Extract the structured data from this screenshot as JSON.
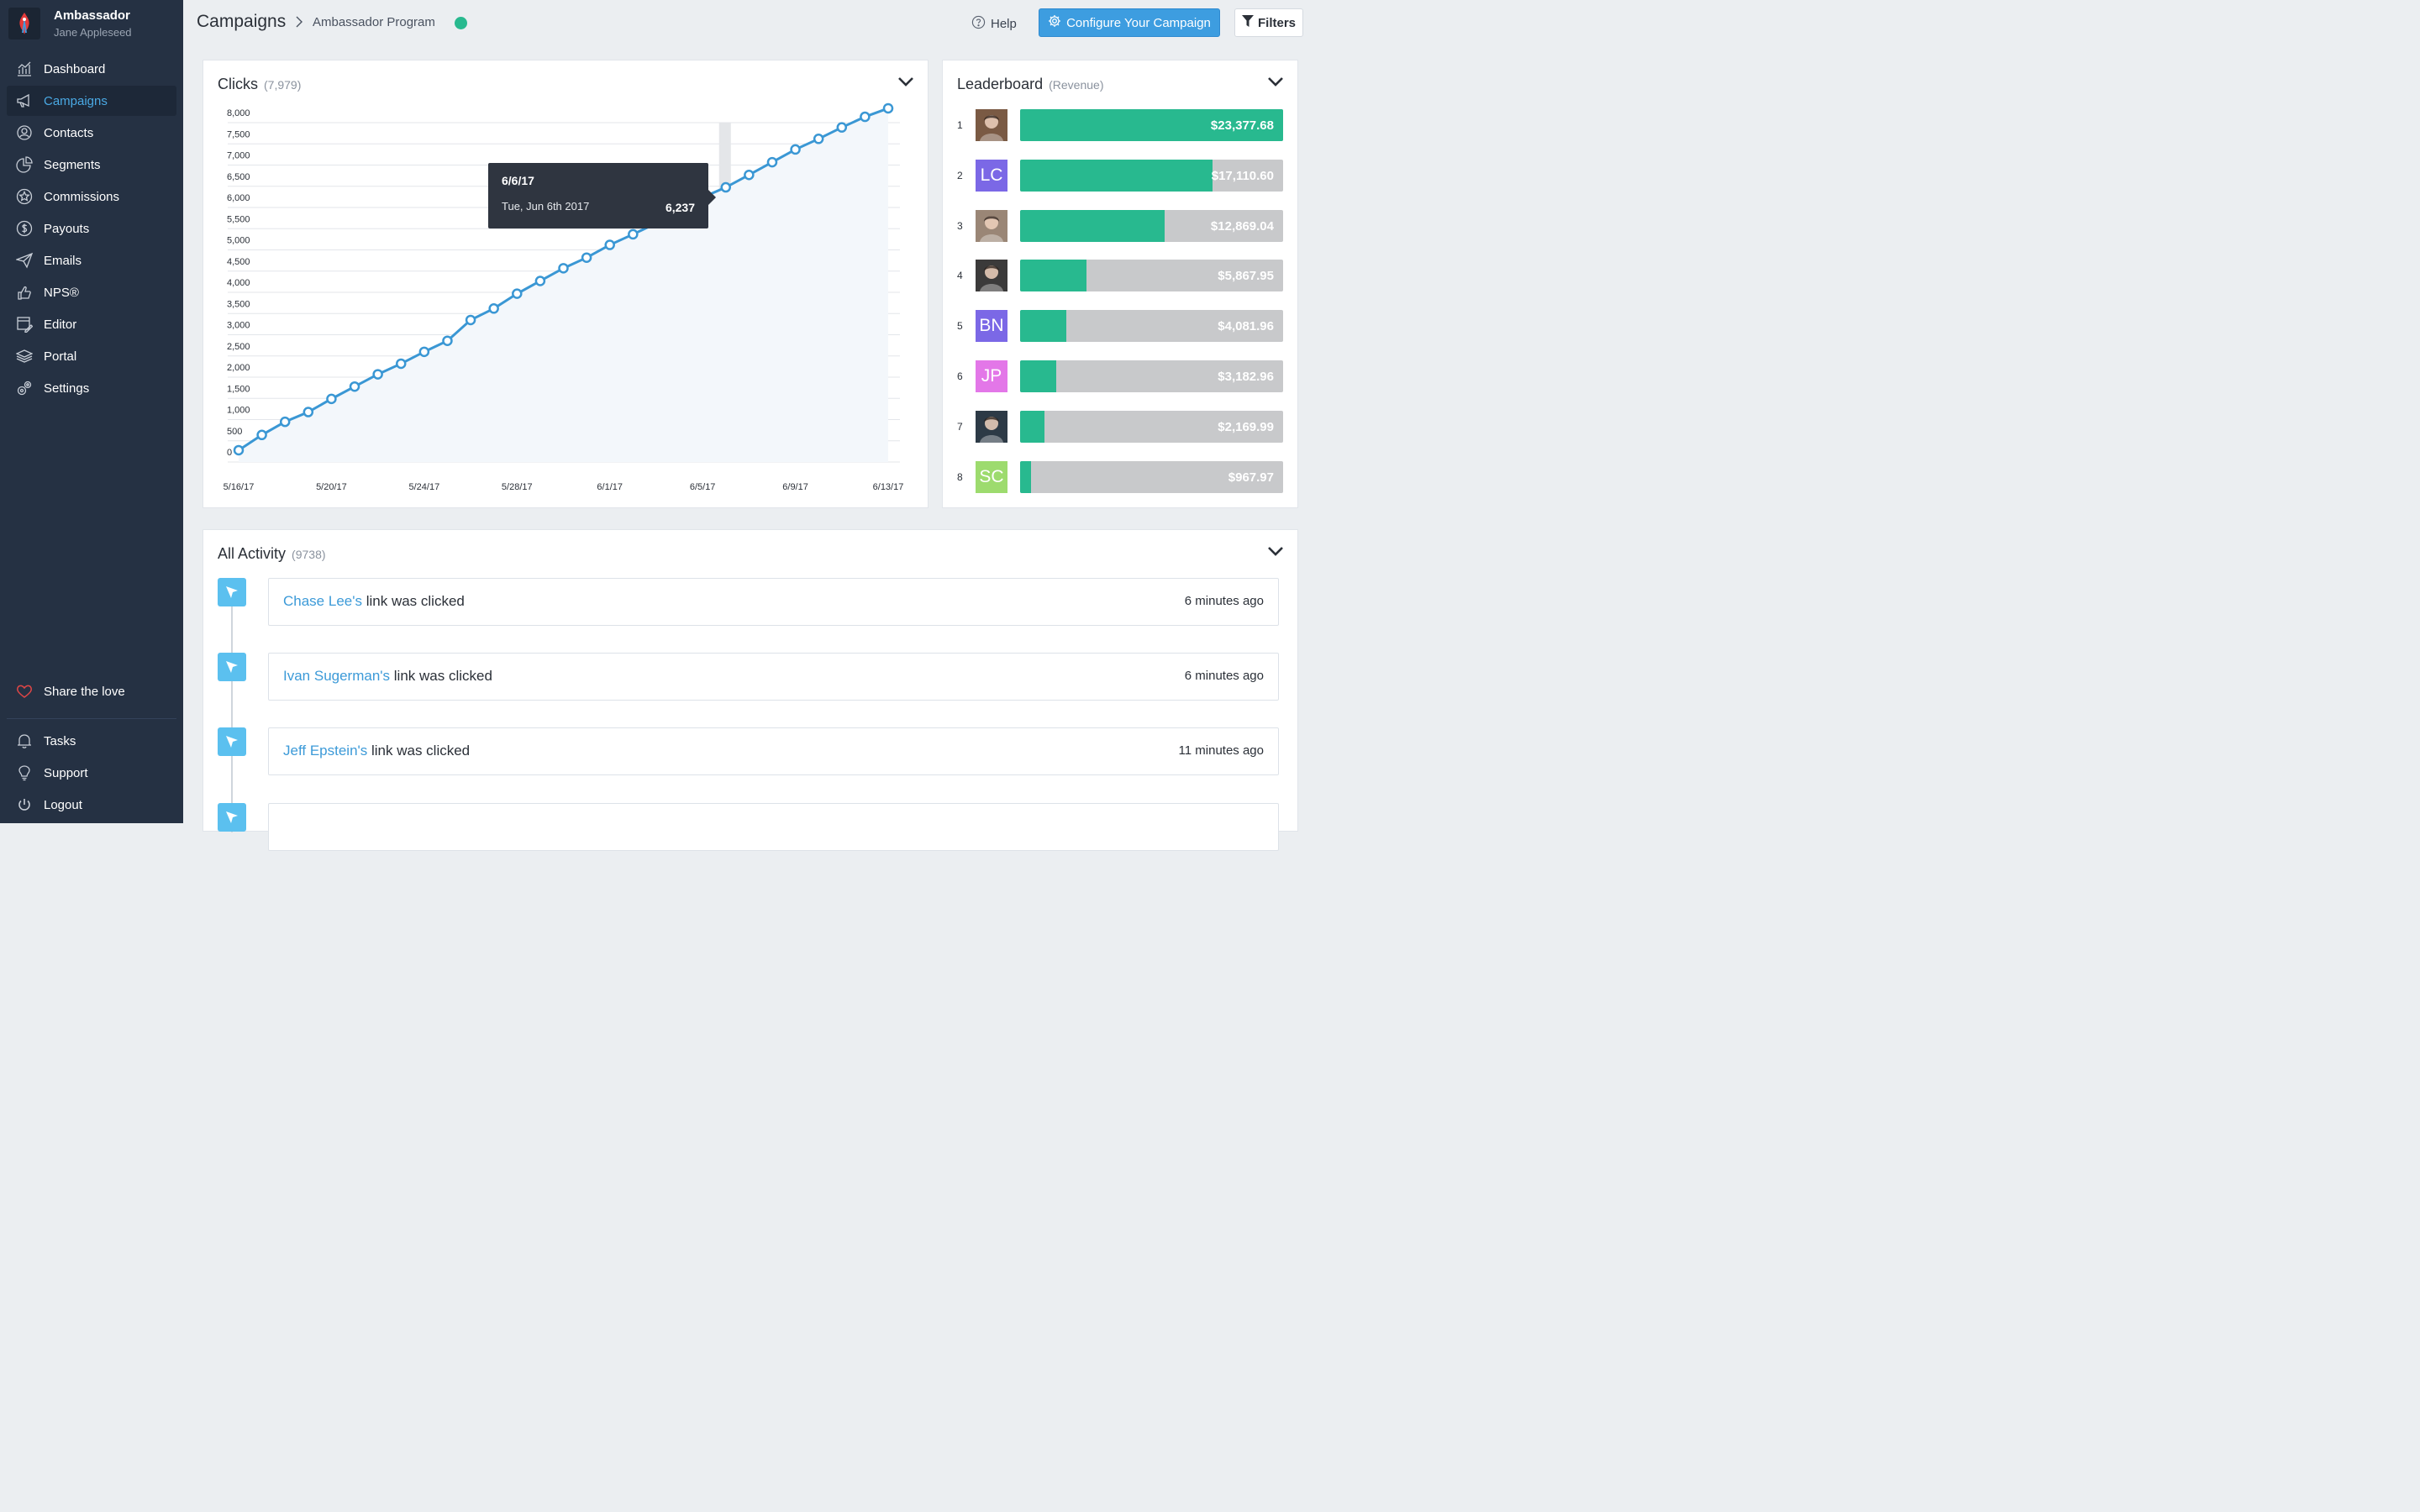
{
  "brand": {
    "name": "Ambassador",
    "user": "Jane Appleseed"
  },
  "nav": [
    {
      "label": "Dashboard",
      "icon": "chart-icon"
    },
    {
      "label": "Campaigns",
      "icon": "megaphone-icon",
      "active": true
    },
    {
      "label": "Contacts",
      "icon": "user-circle-icon"
    },
    {
      "label": "Segments",
      "icon": "pie-icon"
    },
    {
      "label": "Commissions",
      "icon": "star-icon"
    },
    {
      "label": "Payouts",
      "icon": "dollar-icon"
    },
    {
      "label": "Emails",
      "icon": "paper-plane-icon"
    },
    {
      "label": "NPS®",
      "icon": "nps-icon"
    },
    {
      "label": "Editor",
      "icon": "editor-icon"
    },
    {
      "label": "Portal",
      "icon": "layers-icon"
    },
    {
      "label": "Settings",
      "icon": "gears-icon"
    }
  ],
  "nav_bottom": {
    "share": "Share the love",
    "tasks": "Tasks",
    "support": "Support",
    "logout": "Logout"
  },
  "topbar": {
    "title": "Campaigns",
    "subtitle": "Ambassador Program",
    "status_color": "#28b98f",
    "help": "Help",
    "configure": "Configure Your Campaign",
    "filters": "Filters"
  },
  "clicks": {
    "title": "Clicks",
    "count": "(7,979)",
    "tooltip": {
      "date": "6/6/17",
      "long_date": "Tue, Jun 6th 2017",
      "value": "6,237"
    }
  },
  "chart_data": {
    "type": "line",
    "x": [
      "5/16/17",
      "5/17/17",
      "5/18/17",
      "5/19/17",
      "5/20/17",
      "5/21/17",
      "5/22/17",
      "5/23/17",
      "5/24/17",
      "5/25/17",
      "5/26/17",
      "5/27/17",
      "5/28/17",
      "5/29/17",
      "5/30/17",
      "5/31/17",
      "6/1/17",
      "6/2/17",
      "6/3/17",
      "6/4/17",
      "6/5/17",
      "6/6/17",
      "6/7/17",
      "6/8/17",
      "6/9/17",
      "6/10/17",
      "6/11/17",
      "6/12/17",
      "6/13/17"
    ],
    "y": [
      40,
      400,
      710,
      940,
      1250,
      1540,
      1830,
      2080,
      2360,
      2620,
      3110,
      3380,
      3730,
      4030,
      4330,
      4580,
      4880,
      5130,
      5390,
      5620,
      6000,
      6237,
      6530,
      6830,
      7130,
      7380,
      7650,
      7900,
      8100
    ],
    "x_tick_labels": [
      "5/16/17",
      "5/20/17",
      "5/24/17",
      "5/28/17",
      "6/1/17",
      "6/5/17",
      "6/9/17",
      "6/13/17"
    ],
    "y_tick_labels": [
      "0",
      "500",
      "1,000",
      "1,500",
      "2,000",
      "2,500",
      "3,000",
      "3,500",
      "4,000",
      "4,500",
      "5,000",
      "5,500",
      "6,000",
      "6,500",
      "7,000",
      "7,500",
      "8,000"
    ],
    "ylim": [
      0,
      8000
    ],
    "highlight": "6/6/17",
    "line_color": "#3a97d4",
    "grid": true
  },
  "leaderboard": {
    "title": "Leaderboard",
    "subtitle": "(Revenue)",
    "max": 23377.68,
    "rows": [
      {
        "rank": "1",
        "avatar": "photo-avatar",
        "initials": "",
        "avatar_color": "#7a5a44",
        "value": 23377.68,
        "label": "$23,377.68"
      },
      {
        "rank": "2",
        "avatar": "initials-avatar",
        "initials": "LC",
        "avatar_color": "#7b68e6",
        "value": 17110.6,
        "label": "$17,110.60"
      },
      {
        "rank": "3",
        "avatar": "photo-avatar",
        "initials": "",
        "avatar_color": "#9a8676",
        "value": 12869.04,
        "label": "$12,869.04"
      },
      {
        "rank": "4",
        "avatar": "photo-avatar",
        "initials": "",
        "avatar_color": "#3b3a3a",
        "value": 5867.95,
        "label": "$5,867.95"
      },
      {
        "rank": "5",
        "avatar": "initials-avatar",
        "initials": "BN",
        "avatar_color": "#7b68e6",
        "value": 4081.96,
        "label": "$4,081.96"
      },
      {
        "rank": "6",
        "avatar": "initials-avatar",
        "initials": "JP",
        "avatar_color": "#e377e8",
        "value": 3182.96,
        "label": "$3,182.96"
      },
      {
        "rank": "7",
        "avatar": "photo-avatar",
        "initials": "",
        "avatar_color": "#2d3a46",
        "value": 2169.99,
        "label": "$2,169.99"
      },
      {
        "rank": "8",
        "avatar": "initials-avatar",
        "initials": "SC",
        "avatar_color": "#9ddb6e",
        "value": 967.97,
        "label": "$967.97"
      }
    ]
  },
  "activity": {
    "title": "All Activity",
    "count": "(9738)",
    "items": [
      {
        "name": "Chase Lee's",
        "text": " link was clicked",
        "time": "6 minutes ago"
      },
      {
        "name": "Ivan Sugerman's",
        "text": " link was clicked",
        "time": "6 minutes ago"
      },
      {
        "name": "Jeff Epstein's",
        "text": " link was clicked",
        "time": "11 minutes ago"
      }
    ]
  }
}
